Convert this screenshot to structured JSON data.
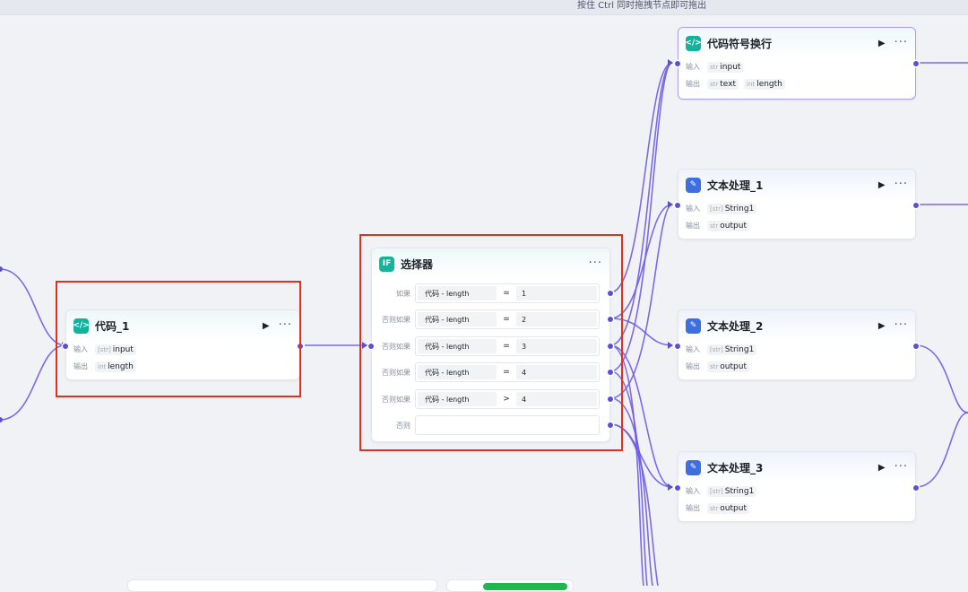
{
  "canvas": {
    "hint": "按住 Ctrl 同时拖拽节点即可拖出"
  },
  "colors": {
    "edge": "#6b5ce7",
    "highlight": "#e0301e",
    "code_icon": "#12b39c",
    "text_icon": "#3d6fe0"
  },
  "labels": {
    "input": "输入",
    "output": "输出"
  },
  "nodes": {
    "code1": {
      "title": "代码_1",
      "icon": "code-icon",
      "input_type": "[str]",
      "input_name": "input",
      "output_type": "int",
      "output_name": "length"
    },
    "selector": {
      "title": "选择器",
      "icon": "if-icon",
      "icon_text": "IF",
      "conditions": [
        {
          "label": "如果",
          "var": "代码 - length",
          "op": "=",
          "value": "1"
        },
        {
          "label": "否则如果",
          "var": "代码 - length",
          "op": "=",
          "value": "2"
        },
        {
          "label": "否则如果",
          "var": "代码 - length",
          "op": "=",
          "value": "3"
        },
        {
          "label": "否则如果",
          "var": "代码 - length",
          "op": "=",
          "value": "4"
        },
        {
          "label": "否则如果",
          "var": "代码 - length",
          "op": ">",
          "value": "4"
        }
      ],
      "else_label": "否则"
    },
    "code_symbol": {
      "title": "代码符号换行",
      "icon": "code-icon",
      "input_type": "str",
      "input_name": "input",
      "output_type_1": "str",
      "output_name_1": "text",
      "output_type_2": "int",
      "output_name_2": "length"
    },
    "text1": {
      "title": "文本处理_1",
      "icon": "text-process-icon",
      "input_type": "[str]",
      "input_name": "String1",
      "output_type": "str",
      "output_name": "output"
    },
    "text2": {
      "title": "文本处理_2",
      "icon": "text-process-icon",
      "input_type": "[str]",
      "input_name": "String1",
      "output_type": "str",
      "output_name": "output"
    },
    "text3": {
      "title": "文本处理_3",
      "icon": "text-process-icon",
      "input_type": "[str]",
      "input_name": "String1",
      "output_type": "str",
      "output_name": "output"
    }
  }
}
